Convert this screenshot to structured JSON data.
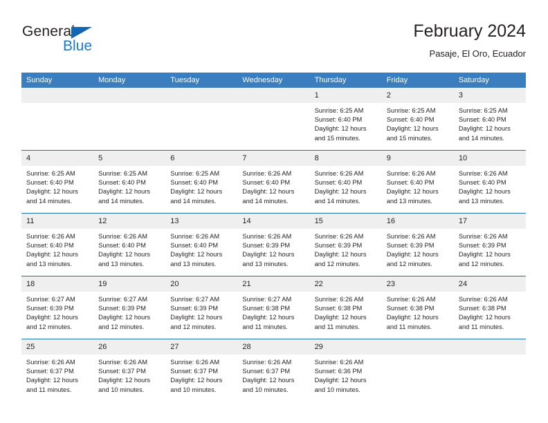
{
  "brand": {
    "name_part1": "General",
    "name_part2": "Blue",
    "triangle_color": "#1267b2",
    "blue_color": "#1b79d0"
  },
  "header": {
    "title": "February 2024",
    "location": "Pasaje, El Oro, Ecuador"
  },
  "theme": {
    "header_row_bg": "#3b7ebf",
    "row_divider": "#1f6cb0",
    "daynum_bg": "#efefef",
    "text": "#231f20"
  },
  "weekdays": [
    "Sunday",
    "Monday",
    "Tuesday",
    "Wednesday",
    "Thursday",
    "Friday",
    "Saturday"
  ],
  "labels": {
    "sunrise_prefix": "Sunrise:",
    "sunset_prefix": "Sunset:",
    "daylight_prefix": "Daylight:"
  },
  "weeks": [
    [
      {
        "day": "",
        "empty": true
      },
      {
        "day": "",
        "empty": true
      },
      {
        "day": "",
        "empty": true
      },
      {
        "day": "",
        "empty": true
      },
      {
        "day": "1",
        "sunrise": "Sunrise: 6:25 AM",
        "sunset": "Sunset: 6:40 PM",
        "daylight1": "Daylight: 12 hours",
        "daylight2": "and 15 minutes."
      },
      {
        "day": "2",
        "sunrise": "Sunrise: 6:25 AM",
        "sunset": "Sunset: 6:40 PM",
        "daylight1": "Daylight: 12 hours",
        "daylight2": "and 15 minutes."
      },
      {
        "day": "3",
        "sunrise": "Sunrise: 6:25 AM",
        "sunset": "Sunset: 6:40 PM",
        "daylight1": "Daylight: 12 hours",
        "daylight2": "and 14 minutes."
      }
    ],
    [
      {
        "day": "4",
        "sunrise": "Sunrise: 6:25 AM",
        "sunset": "Sunset: 6:40 PM",
        "daylight1": "Daylight: 12 hours",
        "daylight2": "and 14 minutes."
      },
      {
        "day": "5",
        "sunrise": "Sunrise: 6:25 AM",
        "sunset": "Sunset: 6:40 PM",
        "daylight1": "Daylight: 12 hours",
        "daylight2": "and 14 minutes."
      },
      {
        "day": "6",
        "sunrise": "Sunrise: 6:25 AM",
        "sunset": "Sunset: 6:40 PM",
        "daylight1": "Daylight: 12 hours",
        "daylight2": "and 14 minutes."
      },
      {
        "day": "7",
        "sunrise": "Sunrise: 6:26 AM",
        "sunset": "Sunset: 6:40 PM",
        "daylight1": "Daylight: 12 hours",
        "daylight2": "and 14 minutes."
      },
      {
        "day": "8",
        "sunrise": "Sunrise: 6:26 AM",
        "sunset": "Sunset: 6:40 PM",
        "daylight1": "Daylight: 12 hours",
        "daylight2": "and 14 minutes."
      },
      {
        "day": "9",
        "sunrise": "Sunrise: 6:26 AM",
        "sunset": "Sunset: 6:40 PM",
        "daylight1": "Daylight: 12 hours",
        "daylight2": "and 13 minutes."
      },
      {
        "day": "10",
        "sunrise": "Sunrise: 6:26 AM",
        "sunset": "Sunset: 6:40 PM",
        "daylight1": "Daylight: 12 hours",
        "daylight2": "and 13 minutes."
      }
    ],
    [
      {
        "day": "11",
        "sunrise": "Sunrise: 6:26 AM",
        "sunset": "Sunset: 6:40 PM",
        "daylight1": "Daylight: 12 hours",
        "daylight2": "and 13 minutes."
      },
      {
        "day": "12",
        "sunrise": "Sunrise: 6:26 AM",
        "sunset": "Sunset: 6:40 PM",
        "daylight1": "Daylight: 12 hours",
        "daylight2": "and 13 minutes."
      },
      {
        "day": "13",
        "sunrise": "Sunrise: 6:26 AM",
        "sunset": "Sunset: 6:40 PM",
        "daylight1": "Daylight: 12 hours",
        "daylight2": "and 13 minutes."
      },
      {
        "day": "14",
        "sunrise": "Sunrise: 6:26 AM",
        "sunset": "Sunset: 6:39 PM",
        "daylight1": "Daylight: 12 hours",
        "daylight2": "and 13 minutes."
      },
      {
        "day": "15",
        "sunrise": "Sunrise: 6:26 AM",
        "sunset": "Sunset: 6:39 PM",
        "daylight1": "Daylight: 12 hours",
        "daylight2": "and 12 minutes."
      },
      {
        "day": "16",
        "sunrise": "Sunrise: 6:26 AM",
        "sunset": "Sunset: 6:39 PM",
        "daylight1": "Daylight: 12 hours",
        "daylight2": "and 12 minutes."
      },
      {
        "day": "17",
        "sunrise": "Sunrise: 6:26 AM",
        "sunset": "Sunset: 6:39 PM",
        "daylight1": "Daylight: 12 hours",
        "daylight2": "and 12 minutes."
      }
    ],
    [
      {
        "day": "18",
        "sunrise": "Sunrise: 6:27 AM",
        "sunset": "Sunset: 6:39 PM",
        "daylight1": "Daylight: 12 hours",
        "daylight2": "and 12 minutes."
      },
      {
        "day": "19",
        "sunrise": "Sunrise: 6:27 AM",
        "sunset": "Sunset: 6:39 PM",
        "daylight1": "Daylight: 12 hours",
        "daylight2": "and 12 minutes."
      },
      {
        "day": "20",
        "sunrise": "Sunrise: 6:27 AM",
        "sunset": "Sunset: 6:39 PM",
        "daylight1": "Daylight: 12 hours",
        "daylight2": "and 12 minutes."
      },
      {
        "day": "21",
        "sunrise": "Sunrise: 6:27 AM",
        "sunset": "Sunset: 6:38 PM",
        "daylight1": "Daylight: 12 hours",
        "daylight2": "and 11 minutes."
      },
      {
        "day": "22",
        "sunrise": "Sunrise: 6:26 AM",
        "sunset": "Sunset: 6:38 PM",
        "daylight1": "Daylight: 12 hours",
        "daylight2": "and 11 minutes."
      },
      {
        "day": "23",
        "sunrise": "Sunrise: 6:26 AM",
        "sunset": "Sunset: 6:38 PM",
        "daylight1": "Daylight: 12 hours",
        "daylight2": "and 11 minutes."
      },
      {
        "day": "24",
        "sunrise": "Sunrise: 6:26 AM",
        "sunset": "Sunset: 6:38 PM",
        "daylight1": "Daylight: 12 hours",
        "daylight2": "and 11 minutes."
      }
    ],
    [
      {
        "day": "25",
        "sunrise": "Sunrise: 6:26 AM",
        "sunset": "Sunset: 6:37 PM",
        "daylight1": "Daylight: 12 hours",
        "daylight2": "and 11 minutes."
      },
      {
        "day": "26",
        "sunrise": "Sunrise: 6:26 AM",
        "sunset": "Sunset: 6:37 PM",
        "daylight1": "Daylight: 12 hours",
        "daylight2": "and 10 minutes."
      },
      {
        "day": "27",
        "sunrise": "Sunrise: 6:26 AM",
        "sunset": "Sunset: 6:37 PM",
        "daylight1": "Daylight: 12 hours",
        "daylight2": "and 10 minutes."
      },
      {
        "day": "28",
        "sunrise": "Sunrise: 6:26 AM",
        "sunset": "Sunset: 6:37 PM",
        "daylight1": "Daylight: 12 hours",
        "daylight2": "and 10 minutes."
      },
      {
        "day": "29",
        "sunrise": "Sunrise: 6:26 AM",
        "sunset": "Sunset: 6:36 PM",
        "daylight1": "Daylight: 12 hours",
        "daylight2": "and 10 minutes."
      },
      {
        "day": "",
        "empty": true
      },
      {
        "day": "",
        "empty": true
      }
    ]
  ]
}
